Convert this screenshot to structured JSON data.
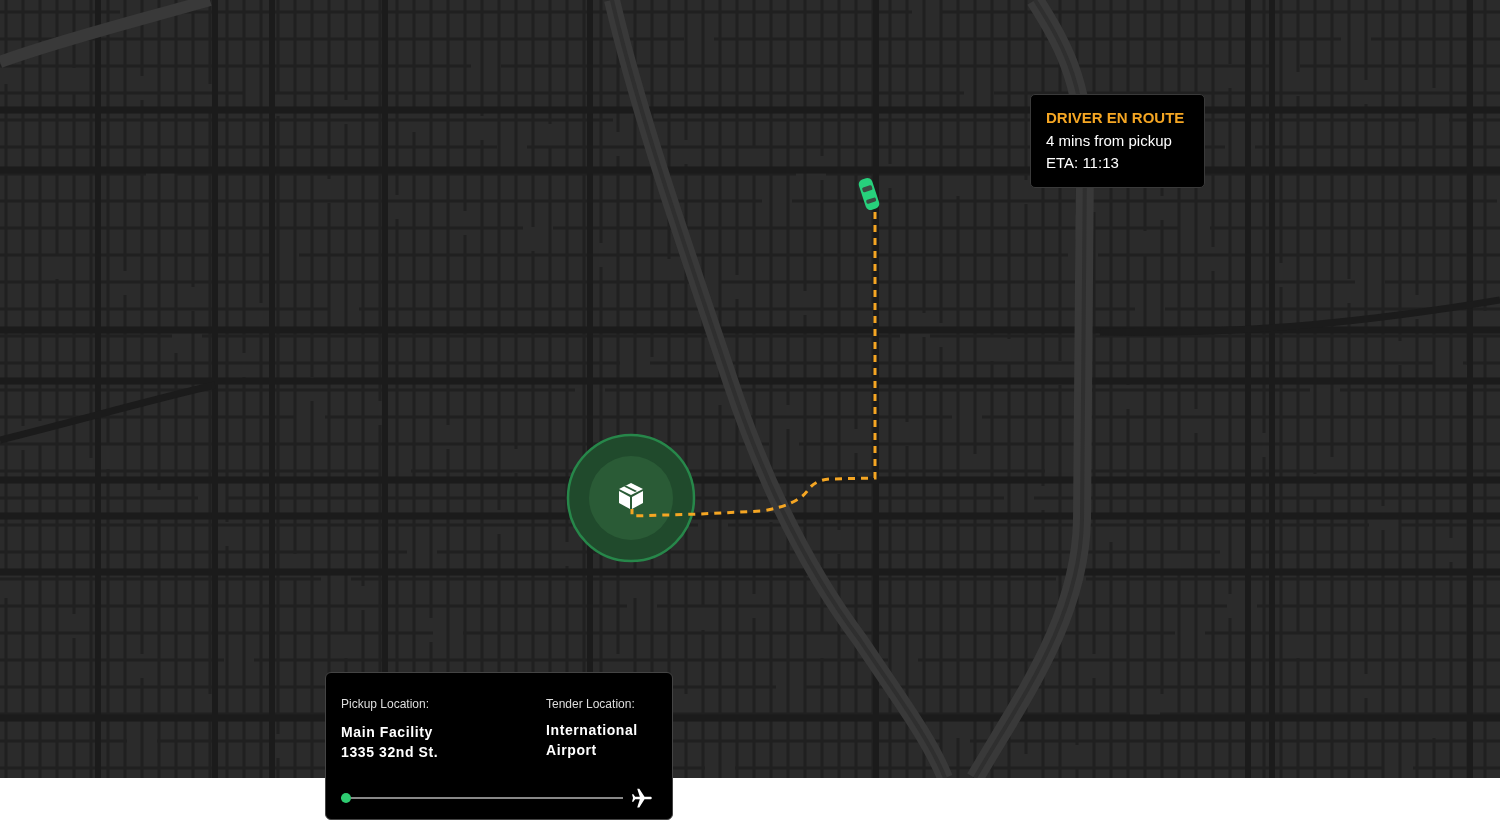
{
  "status_card": {
    "title": "DRIVER EN ROUTE",
    "lines": [
      "4 mins from pickup",
      "ETA: 11:13"
    ]
  },
  "trip_card": {
    "pickup": {
      "label": "Pickup Location:",
      "lines": [
        "Main Facility",
        "1335 32nd St."
      ]
    },
    "tender": {
      "label": "Tender Location:",
      "lines": [
        "International",
        "Airport"
      ]
    },
    "progress": {
      "level": 0
    }
  }
}
